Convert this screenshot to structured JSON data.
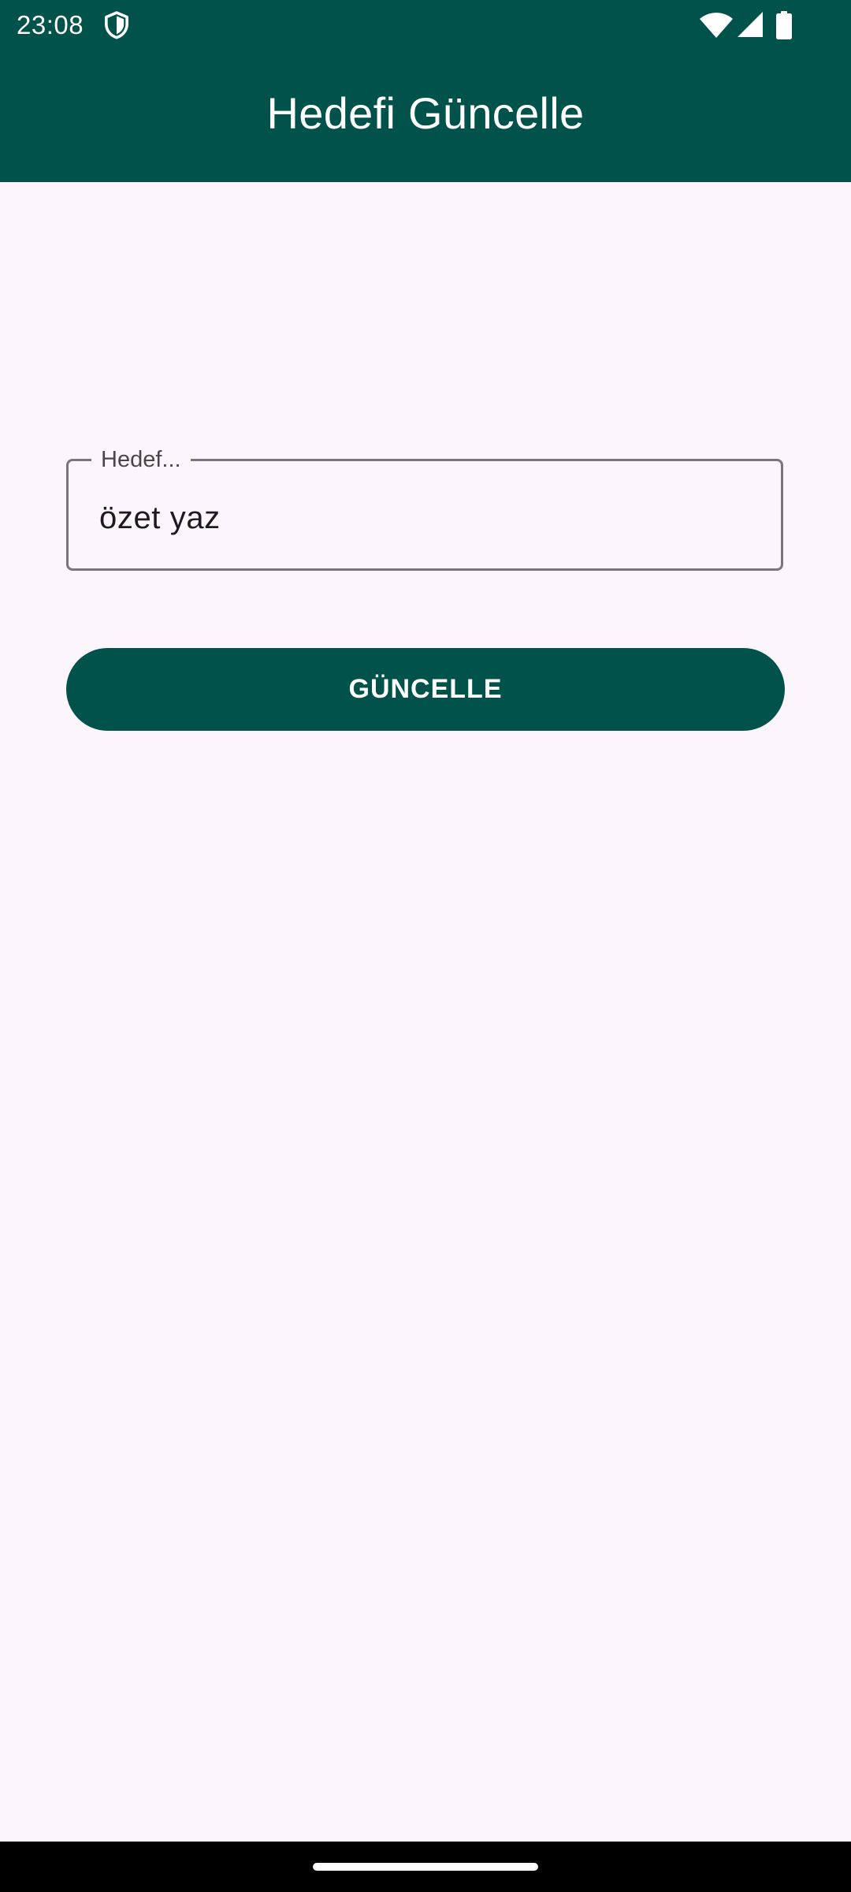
{
  "status_bar": {
    "time": "23:08",
    "icons": [
      "shield-icon",
      "wifi-icon",
      "cellular-signal-icon",
      "battery-icon"
    ]
  },
  "app_bar": {
    "title": "Hedefi Güncelle"
  },
  "form": {
    "field_label": "Hedef...",
    "field_value": "özet yaz",
    "button_label": "GÜNCELLE"
  },
  "colors": {
    "primary": "#00524a",
    "background": "#fcf6fc",
    "outline": "#7a757a",
    "on_primary": "#ffffff"
  }
}
